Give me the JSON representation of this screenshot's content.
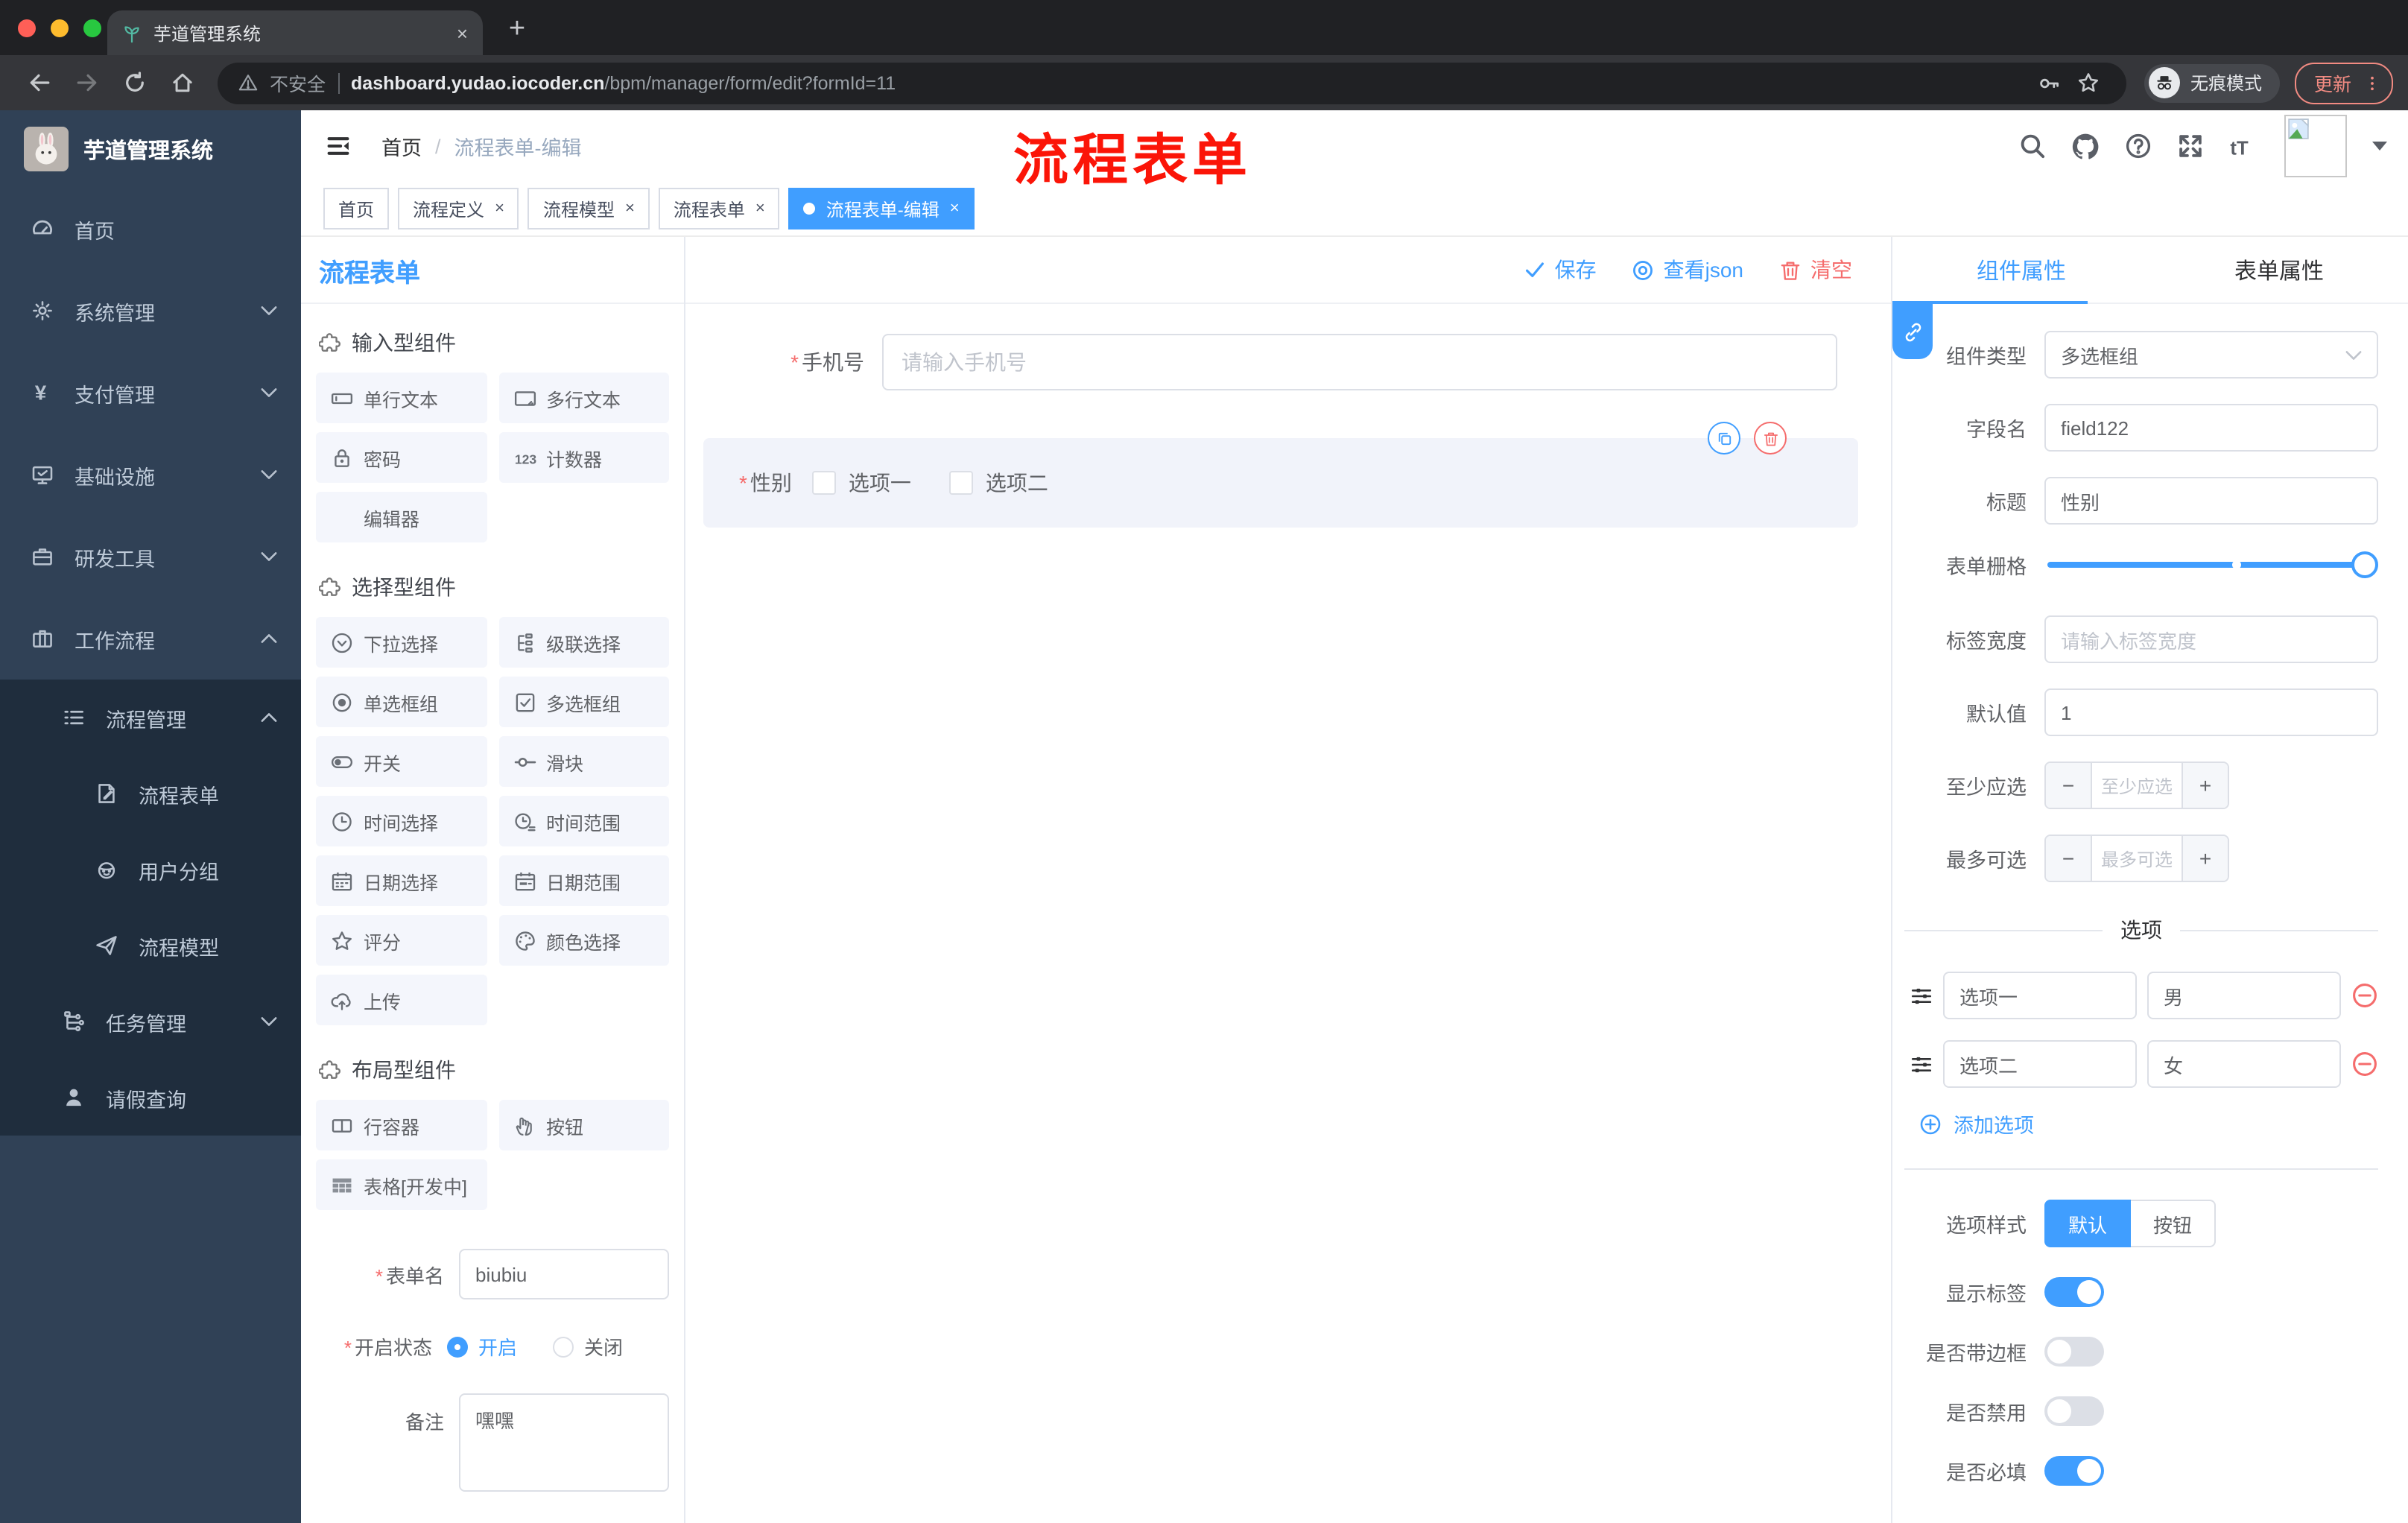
{
  "ui": {
    "required_mark": "*",
    "breadcrumb_sep": "/",
    "close_glyph": "×",
    "plus_glyph": "+",
    "minus_glyph": "−"
  },
  "colors": {
    "accent": "#409EFF",
    "danger": "#F56C6C",
    "annotation_red": "#FB1508",
    "sidebar_bg": "#304156",
    "submenu_bg": "#1F2D3D"
  },
  "browser": {
    "tab_title": "芋道管理系统",
    "security_label": "不安全",
    "url_host": "dashboard.yudao.iocoder.cn",
    "url_path": "/bpm/manager/form/edit?formId=11",
    "incognito_label": "无痕模式",
    "update_label": "更新"
  },
  "sidebar": {
    "brand": "芋道管理系统",
    "items": [
      {
        "icon": "dashboard-icon",
        "label": "首页"
      },
      {
        "icon": "gear-icon",
        "label": "系统管理",
        "chevron": "down"
      },
      {
        "icon": "yen-icon",
        "label": "支付管理",
        "chevron": "down"
      },
      {
        "icon": "monitor-icon",
        "label": "基础设施",
        "chevron": "down"
      },
      {
        "icon": "briefcase-icon",
        "label": "研发工具",
        "chevron": "down"
      },
      {
        "icon": "suitcase-icon",
        "label": "工作流程",
        "chevron": "up"
      },
      {
        "icon": "list-icon",
        "label": "流程管理",
        "chevron": "up"
      },
      {
        "icon": "document-edit-icon",
        "label": "流程表单"
      },
      {
        "icon": "face-icon",
        "label": "用户分组"
      },
      {
        "icon": "paper-plane-icon",
        "label": "流程模型"
      },
      {
        "icon": "tree-icon",
        "label": "任务管理",
        "chevron": "down"
      },
      {
        "icon": "person-icon",
        "label": "请假查询"
      }
    ]
  },
  "header": {
    "breadcrumb": [
      "首页",
      "流程表单-编辑"
    ],
    "annotation": "流程表单"
  },
  "tags": [
    {
      "label": "首页",
      "closable": false,
      "active": false
    },
    {
      "label": "流程定义",
      "closable": true,
      "active": false
    },
    {
      "label": "流程模型",
      "closable": true,
      "active": false
    },
    {
      "label": "流程表单",
      "closable": true,
      "active": false
    },
    {
      "label": "流程表单-编辑",
      "closable": true,
      "active": true
    }
  ],
  "builder": {
    "title": "流程表单",
    "actions": {
      "save": "保存",
      "view_json": "查看json",
      "clear": "清空"
    },
    "sections": [
      {
        "title": "输入型组件",
        "items": [
          {
            "icon": "text-input-icon",
            "label": "单行文本"
          },
          {
            "icon": "textarea-icon",
            "label": "多行文本"
          },
          {
            "icon": "password-icon",
            "label": "密码"
          },
          {
            "icon": "counter-icon",
            "label": "计数器"
          },
          {
            "icon": "editor-icon",
            "label": "编辑器"
          }
        ]
      },
      {
        "title": "选择型组件",
        "items": [
          {
            "icon": "dropdown-icon",
            "label": "下拉选择"
          },
          {
            "icon": "cascader-icon",
            "label": "级联选择"
          },
          {
            "icon": "radio-group-icon",
            "label": "单选框组"
          },
          {
            "icon": "checkbox-group-icon",
            "label": "多选框组"
          },
          {
            "icon": "switch-icon",
            "label": "开关"
          },
          {
            "icon": "slider-icon",
            "label": "滑块"
          },
          {
            "icon": "time-icon",
            "label": "时间选择"
          },
          {
            "icon": "time-range-icon",
            "label": "时间范围"
          },
          {
            "icon": "date-icon",
            "label": "日期选择"
          },
          {
            "icon": "date-range-icon",
            "label": "日期范围"
          },
          {
            "icon": "rate-icon",
            "label": "评分"
          },
          {
            "icon": "color-icon",
            "label": "颜色选择"
          },
          {
            "icon": "upload-icon",
            "label": "上传"
          }
        ]
      },
      {
        "title": "布局型组件",
        "items": [
          {
            "icon": "row-container-icon",
            "label": "行容器"
          },
          {
            "icon": "button-icon",
            "label": "按钮"
          },
          {
            "icon": "table-icon",
            "label": "表格[开发中]"
          }
        ]
      }
    ],
    "form_meta": {
      "name_label": "表单名",
      "name_value": "biubiu",
      "status_label": "开启状态",
      "status_on": "开启",
      "status_off": "关闭",
      "remark_label": "备注",
      "remark_value": "嘿嘿"
    }
  },
  "canvas": {
    "phone": {
      "label": "手机号",
      "placeholder": "请输入手机号"
    },
    "gender": {
      "label": "性别",
      "options": [
        "选项一",
        "选项二"
      ]
    }
  },
  "props": {
    "tabs": [
      "组件属性",
      "表单属性"
    ],
    "fields": {
      "component_type_label": "组件类型",
      "component_type_value": "多选框组",
      "field_name_label": "字段名",
      "field_name_value": "field122",
      "title_label": "标题",
      "title_value": "性别",
      "grid_label": "表单栅格",
      "label_width_label": "标签宽度",
      "label_width_placeholder": "请输入标签宽度",
      "default_label": "默认值",
      "default_value": "1",
      "min_label": "至少应选",
      "min_placeholder": "至少应选",
      "max_label": "最多可选",
      "max_placeholder": "最多可选"
    },
    "options_divider": "选项",
    "options": [
      {
        "label": "选项一",
        "value": "男"
      },
      {
        "label": "选项二",
        "value": "女"
      }
    ],
    "add_option": "添加选项",
    "style_label": "选项样式",
    "style_default": "默认",
    "style_button": "按钮",
    "switches": [
      {
        "label": "显示标签",
        "on": true
      },
      {
        "label": "是否带边框",
        "on": false
      },
      {
        "label": "是否禁用",
        "on": false
      },
      {
        "label": "是否必填",
        "on": true
      }
    ]
  }
}
